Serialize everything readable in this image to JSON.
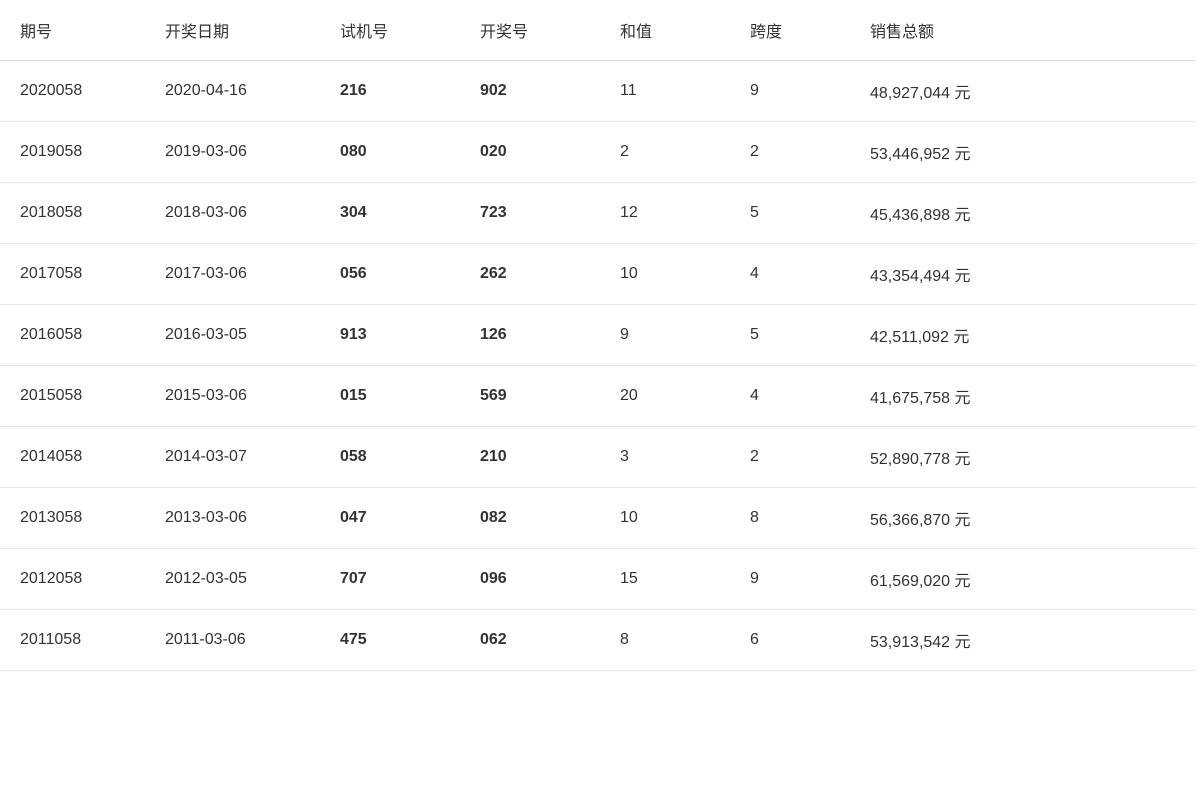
{
  "table": {
    "headers": [
      "期号",
      "开奖日期",
      "试机号",
      "开奖号",
      "和值",
      "跨度",
      "销售总额"
    ],
    "rows": [
      {
        "qihao": "2020058",
        "date": "2020-04-16",
        "shiji": "216",
        "kaijang": "902",
        "hezhi": "11",
        "kuadu": "9",
        "xiaoshou": "48,927,044 元"
      },
      {
        "qihao": "2019058",
        "date": "2019-03-06",
        "shiji": "080",
        "kaijang": "020",
        "hezhi": "2",
        "kuadu": "2",
        "xiaoshou": "53,446,952 元"
      },
      {
        "qihao": "2018058",
        "date": "2018-03-06",
        "shiji": "304",
        "kaijang": "723",
        "hezhi": "12",
        "kuadu": "5",
        "xiaoshou": "45,436,898 元"
      },
      {
        "qihao": "2017058",
        "date": "2017-03-06",
        "shiji": "056",
        "kaijang": "262",
        "hezhi": "10",
        "kuadu": "4",
        "xiaoshou": "43,354,494 元"
      },
      {
        "qihao": "2016058",
        "date": "2016-03-05",
        "shiji": "913",
        "kaijang": "126",
        "hezhi": "9",
        "kuadu": "5",
        "xiaoshou": "42,511,092 元"
      },
      {
        "qihao": "2015058",
        "date": "2015-03-06",
        "shiji": "015",
        "kaijang": "569",
        "hezhi": "20",
        "kuadu": "4",
        "xiaoshou": "41,675,758 元"
      },
      {
        "qihao": "2014058",
        "date": "2014-03-07",
        "shiji": "058",
        "kaijang": "210",
        "hezhi": "3",
        "kuadu": "2",
        "xiaoshou": "52,890,778 元"
      },
      {
        "qihao": "2013058",
        "date": "2013-03-06",
        "shiji": "047",
        "kaijang": "082",
        "hezhi": "10",
        "kuadu": "8",
        "xiaoshou": "56,366,870 元"
      },
      {
        "qihao": "2012058",
        "date": "2012-03-05",
        "shiji": "707",
        "kaijang": "096",
        "hezhi": "15",
        "kuadu": "9",
        "xiaoshou": "61,569,020 元"
      },
      {
        "qihao": "2011058",
        "date": "2011-03-06",
        "shiji": "475",
        "kaijang": "062",
        "hezhi": "8",
        "kuadu": "6",
        "xiaoshou": "53,913,542 元"
      }
    ]
  }
}
